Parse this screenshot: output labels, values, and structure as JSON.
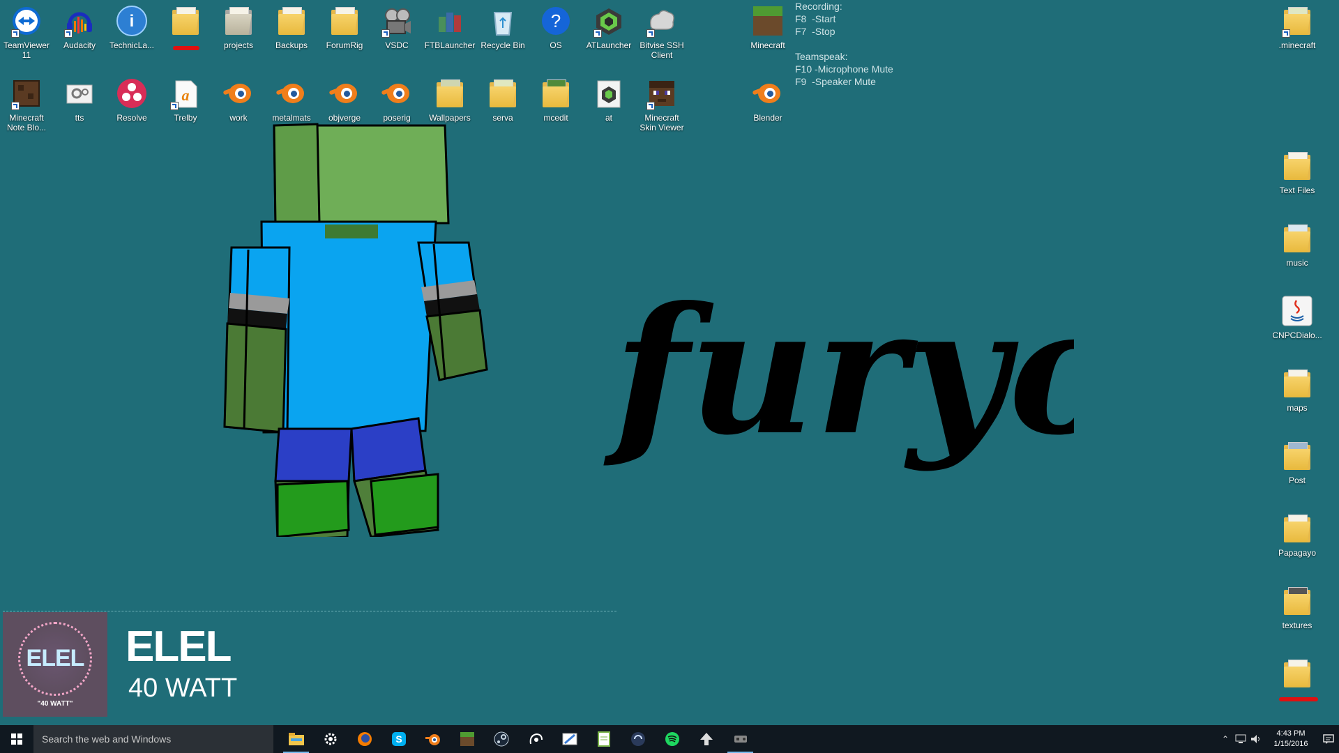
{
  "desktop": {
    "icons_row1": [
      {
        "label": "TeamViewer 11",
        "icon": "teamviewer-icon"
      },
      {
        "label": "Audacity",
        "icon": "audacity-icon"
      },
      {
        "label": "TechnicLa...",
        "icon": "technic-launcher-icon"
      },
      {
        "label": "",
        "icon": "folder-icon",
        "redacted": true
      },
      {
        "label": "projects",
        "icon": "folder-icon"
      },
      {
        "label": "Backups",
        "icon": "folder-icon"
      },
      {
        "label": "ForumRig",
        "icon": "folder-icon"
      },
      {
        "label": "VSDC",
        "icon": "vsdc-icon"
      },
      {
        "label": "FTBLauncher",
        "icon": "ftb-launcher-icon"
      },
      {
        "label": "Recycle Bin",
        "icon": "recycle-bin-icon"
      },
      {
        "label": "OS",
        "icon": "help-icon"
      },
      {
        "label": "ATLauncher",
        "icon": "atlauncher-icon"
      },
      {
        "label": "Bitvise SSH Client",
        "icon": "bitvise-icon"
      },
      {
        "label": "Minecraft",
        "icon": "minecraft-icon"
      }
    ],
    "icons_row2": [
      {
        "label": "Minecraft Note Blo...",
        "icon": "note-block-icon"
      },
      {
        "label": "tts",
        "icon": "settings-file-icon"
      },
      {
        "label": "Resolve",
        "icon": "resolve-icon"
      },
      {
        "label": "Trelby",
        "icon": "trelby-icon"
      },
      {
        "label": "work",
        "icon": "blender-file-icon"
      },
      {
        "label": "metalmats",
        "icon": "blender-file-icon"
      },
      {
        "label": "objverge",
        "icon": "blender-file-icon"
      },
      {
        "label": "poserig",
        "icon": "blender-file-icon"
      },
      {
        "label": "Wallpapers",
        "icon": "folder-icon"
      },
      {
        "label": "serva",
        "icon": "folder-icon"
      },
      {
        "label": "mcedit",
        "icon": "mcedit-icon"
      },
      {
        "label": "at",
        "icon": "at-icon"
      },
      {
        "label": "Minecraft Skin Viewer",
        "icon": "skin-viewer-icon"
      },
      {
        "label": "Blender",
        "icon": "blender-icon"
      }
    ],
    "icons_right": [
      {
        "label": ".minecraft",
        "icon": "folder-icon"
      },
      {
        "label": "Text Files",
        "icon": "folder-icon"
      },
      {
        "label": "music",
        "icon": "folder-icon"
      },
      {
        "label": "CNPCDialo...",
        "icon": "java-icon"
      },
      {
        "label": "maps",
        "icon": "folder-icon"
      },
      {
        "label": "Post",
        "icon": "folder-icon"
      },
      {
        "label": "Papagayo",
        "icon": "folder-icon"
      },
      {
        "label": "textures",
        "icon": "folder-icon"
      },
      {
        "label": "",
        "icon": "folder-icon",
        "redacted": true
      }
    ]
  },
  "overlay": {
    "recording_title": "Recording:",
    "recording_start": "F8  -Start",
    "recording_stop": "F7  -Stop",
    "teamspeak_title": "Teamspeak:",
    "teamspeak_mic": "F10 -Microphone Mute",
    "teamspeak_speaker": "F9  -Speaker Mute"
  },
  "wallpaper": {
    "signature": "furyos"
  },
  "now_playing": {
    "artist": "ELEL",
    "track": "40 WATT",
    "art_logo": "ELEL",
    "art_subtitle": "\"40 WATT\""
  },
  "taskbar": {
    "search_placeholder": "Search the web and Windows",
    "apps": [
      "file-explorer-icon",
      "settings-icon",
      "firefox-icon",
      "skype-icon",
      "blender-icon",
      "minecraft-icon",
      "steam-icon",
      "ubisoft-icon",
      "paint-icon",
      "notepad-icon",
      "teamspeak-icon",
      "spotify-icon",
      "inkscape-icon",
      "game-icon"
    ],
    "time": "4:43 PM",
    "date": "1/15/2016"
  },
  "colors": {
    "desktop_bg": "#1f6d78",
    "taskbar_bg": "#101820",
    "accent": "#76b9ed"
  }
}
